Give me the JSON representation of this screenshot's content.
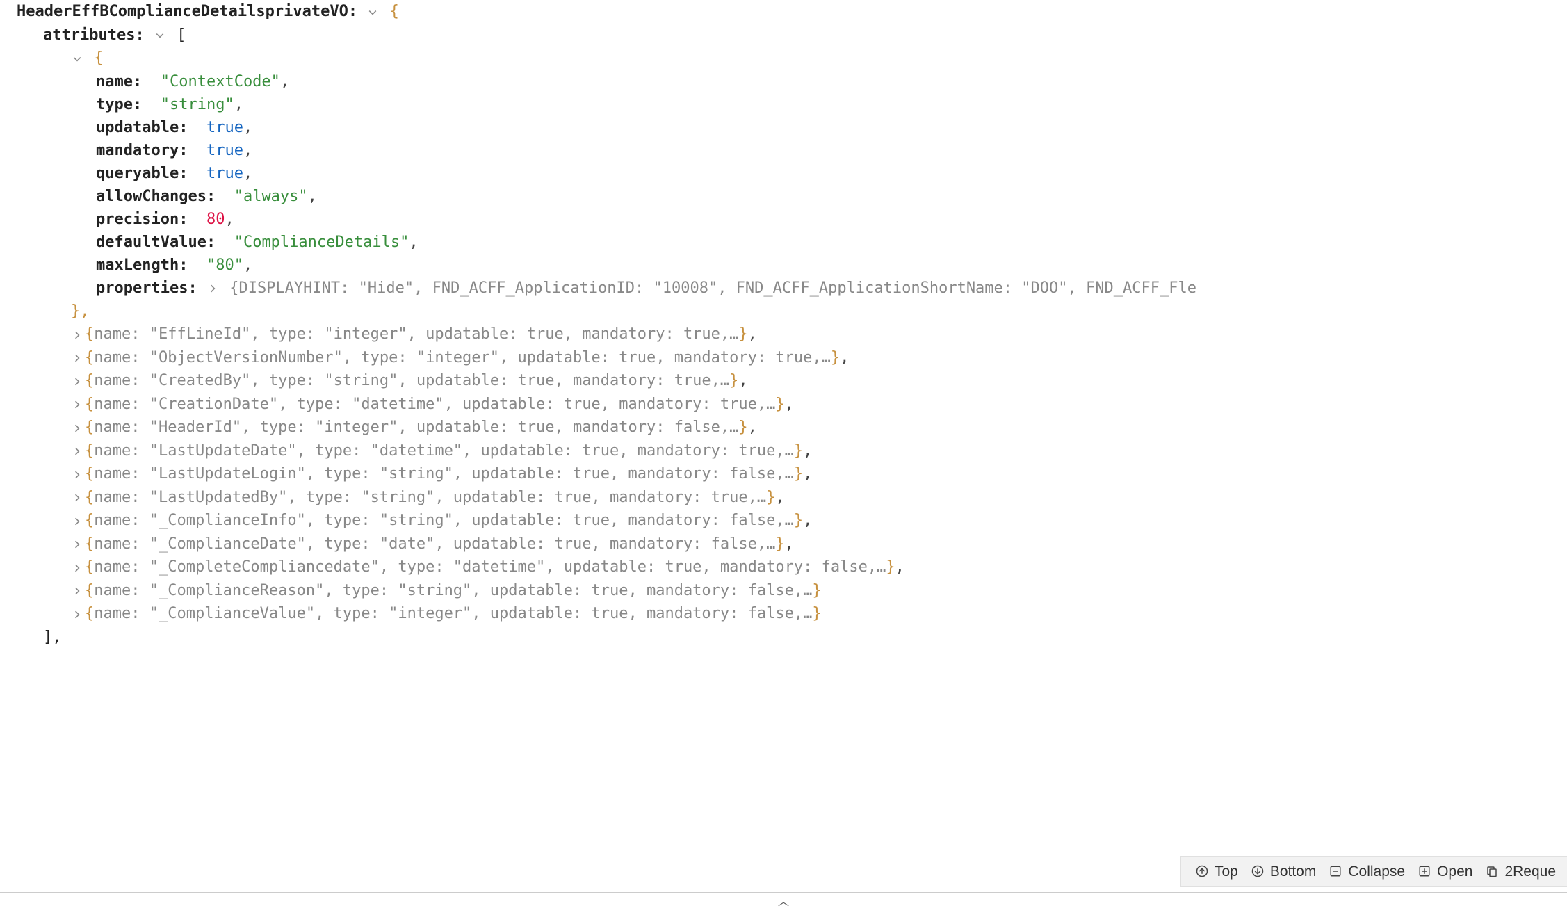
{
  "root_key": "HeaderEffBComplianceDetailsprivateVO",
  "attributes_key": "attributes",
  "open_brace": "{",
  "close_brace": "}",
  "open_brack": "[",
  "close_brack": "]",
  "ellipsis": "…",
  "arr_end_comma": "],",
  "caret_down": "▼",
  "caret_right": "▶",
  "expanded": {
    "name": {
      "k": "name",
      "v": "\"ContextCode\""
    },
    "type": {
      "k": "type",
      "v": "\"string\""
    },
    "updatable": {
      "k": "updatable",
      "v": "true"
    },
    "mandatory": {
      "k": "mandatory",
      "v": "true"
    },
    "queryable": {
      "k": "queryable",
      "v": "true"
    },
    "allowChanges": {
      "k": "allowChanges",
      "v": "\"always\""
    },
    "precision": {
      "k": "precision",
      "v": "80"
    },
    "defaultValue": {
      "k": "defaultValue",
      "v": "\"ComplianceDetails\""
    },
    "maxLength": {
      "k": "maxLength",
      "v": "\"80\""
    },
    "properties": {
      "k": "properties",
      "preview": "{DISPLAYHINT:  \"Hide\", FND_ACFF_ApplicationID:  \"10008\", FND_ACFF_ApplicationShortName:  \"DOO\", FND_ACFF_Fle"
    }
  },
  "expanded_close": "},",
  "collapsed_rows": [
    "{name:  \"EffLineId\", type:  \"integer\", updatable:  true, mandatory:  true,…},",
    "{name:  \"ObjectVersionNumber\", type:  \"integer\", updatable:  true, mandatory:  true,…},",
    "{name:  \"CreatedBy\", type:  \"string\", updatable:  true, mandatory:  true,…},",
    "{name:  \"CreationDate\", type:  \"datetime\", updatable:  true, mandatory:  true,…},",
    "{name:  \"HeaderId\", type:  \"integer\", updatable:  true, mandatory:  false,…},",
    "{name:  \"LastUpdateDate\", type:  \"datetime\", updatable:  true, mandatory:  true,…},",
    "{name:  \"LastUpdateLogin\", type:  \"string\", updatable:  true, mandatory:  false,…},",
    "{name:  \"LastUpdatedBy\", type:  \"string\", updatable:  true, mandatory:  true,…},",
    "{name:  \"_ComplianceInfo\", type:  \"string\", updatable:  true, mandatory:  false,…},",
    "{name:  \"_ComplianceDate\", type:  \"date\", updatable:  true, mandatory:  false,…},",
    "{name:  \"_CompleteCompliancedate\", type:  \"datetime\", updatable:  true, mandatory:  false,…},",
    "{name:  \"_ComplianceReason\", type:  \"string\", updatable:  true, mandatory:  false,…}",
    "{name:  \"_ComplianceValue\", type:  \"integer\", updatable:  true, mandatory:  false,…}"
  ],
  "toolbar": {
    "top": "Top",
    "bottom": "Bottom",
    "collapse": "Collapse",
    "open": "Open",
    "requests": "2Reque"
  },
  "chart_data": {
    "type": "table",
    "title": "HeaderEffBComplianceDetailsprivateVO.attributes",
    "columns": [
      "name",
      "type",
      "updatable",
      "mandatory",
      "queryable",
      "allowChanges",
      "precision",
      "defaultValue",
      "maxLength"
    ],
    "rows": [
      {
        "name": "ContextCode",
        "type": "string",
        "updatable": true,
        "mandatory": true,
        "queryable": true,
        "allowChanges": "always",
        "precision": 80,
        "defaultValue": "ComplianceDetails",
        "maxLength": "80",
        "properties": {
          "DISPLAYHINT": "Hide",
          "FND_ACFF_ApplicationID": "10008",
          "FND_ACFF_ApplicationShortName": "DOO"
        }
      },
      {
        "name": "EffLineId",
        "type": "integer",
        "updatable": true,
        "mandatory": true
      },
      {
        "name": "ObjectVersionNumber",
        "type": "integer",
        "updatable": true,
        "mandatory": true
      },
      {
        "name": "CreatedBy",
        "type": "string",
        "updatable": true,
        "mandatory": true
      },
      {
        "name": "CreationDate",
        "type": "datetime",
        "updatable": true,
        "mandatory": true
      },
      {
        "name": "HeaderId",
        "type": "integer",
        "updatable": true,
        "mandatory": false
      },
      {
        "name": "LastUpdateDate",
        "type": "datetime",
        "updatable": true,
        "mandatory": true
      },
      {
        "name": "LastUpdateLogin",
        "type": "string",
        "updatable": true,
        "mandatory": false
      },
      {
        "name": "LastUpdatedBy",
        "type": "string",
        "updatable": true,
        "mandatory": true
      },
      {
        "name": "_ComplianceInfo",
        "type": "string",
        "updatable": true,
        "mandatory": false
      },
      {
        "name": "_ComplianceDate",
        "type": "date",
        "updatable": true,
        "mandatory": false
      },
      {
        "name": "_CompleteCompliancedate",
        "type": "datetime",
        "updatable": true,
        "mandatory": false
      },
      {
        "name": "_ComplianceReason",
        "type": "string",
        "updatable": true,
        "mandatory": false
      },
      {
        "name": "_ComplianceValue",
        "type": "integer",
        "updatable": true,
        "mandatory": false
      }
    ]
  }
}
